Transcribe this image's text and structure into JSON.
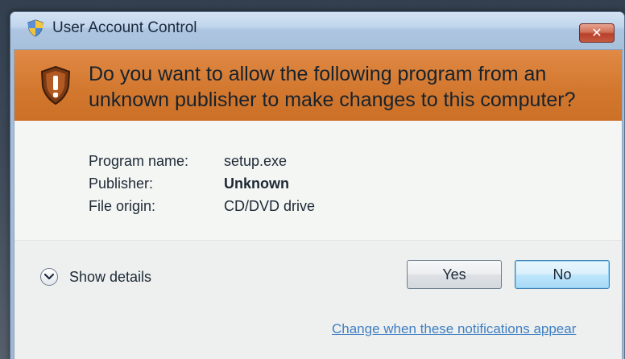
{
  "window": {
    "title": "User Account Control",
    "close_label": "✕",
    "title_icon": "uac-shield-icon",
    "close_icon": "close-icon"
  },
  "banner": {
    "icon": "warning-shield-icon",
    "question": "Do you want to allow the following program from an unknown publisher to make changes to this computer?",
    "color": "#d3782f"
  },
  "info": {
    "rows": [
      {
        "label": "Program name:",
        "value": "setup.exe"
      },
      {
        "label": "Publisher:",
        "value": "Unknown"
      },
      {
        "label": "File origin:",
        "value": "CD/DVD drive"
      }
    ]
  },
  "footer": {
    "details_label": "Show details",
    "details_icon": "chevron-down-icon",
    "yes_label": "Yes",
    "no_label": "No",
    "notification_link": "Change when these notifications appear"
  }
}
